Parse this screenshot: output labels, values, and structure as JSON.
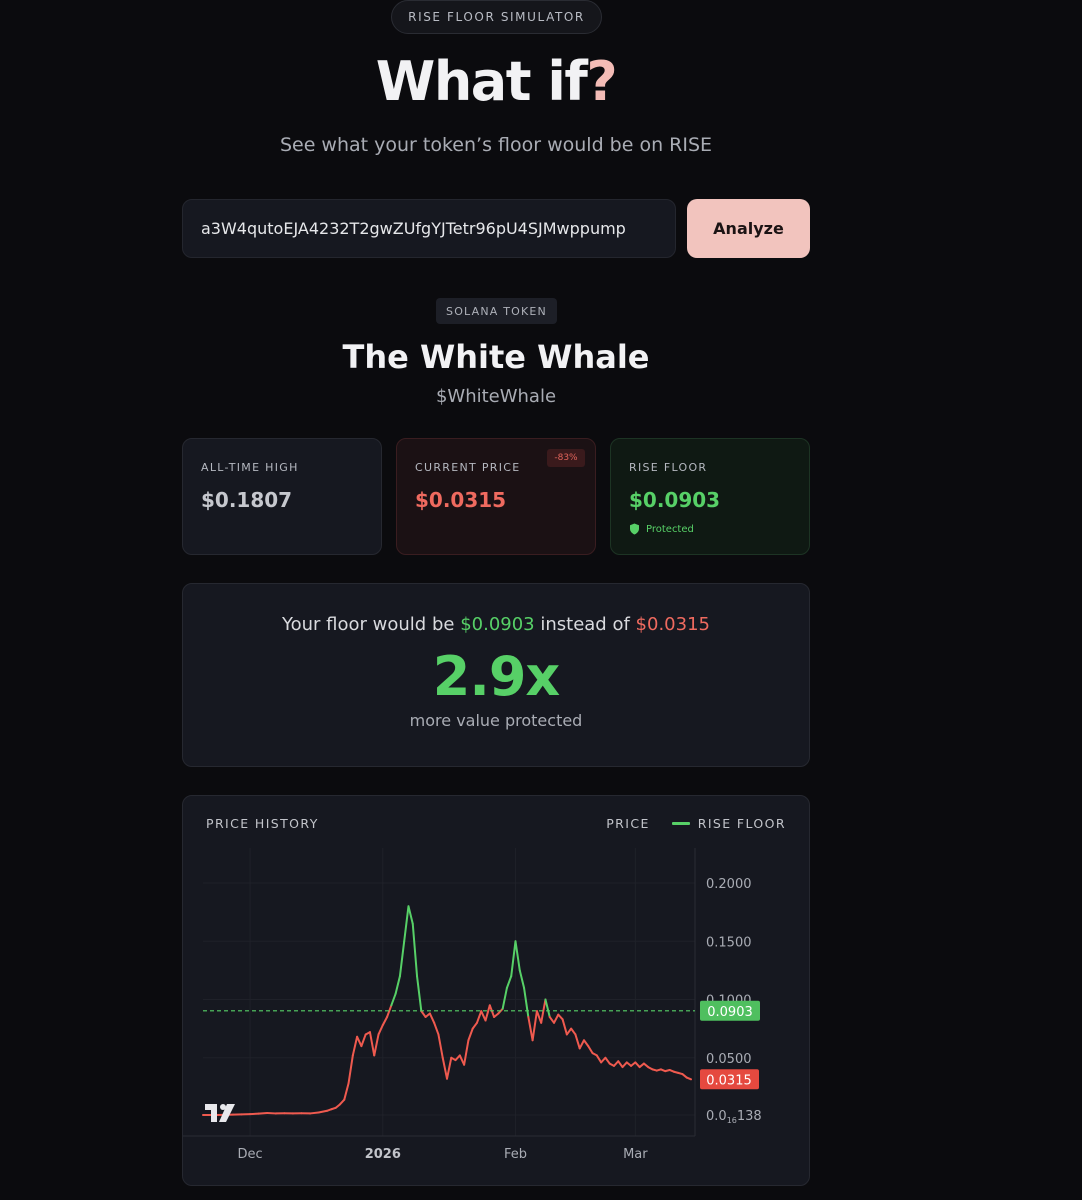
{
  "header": {
    "pill": "RISE FLOOR SIMULATOR",
    "title_main": "What if",
    "title_mark": "?",
    "subtitle": "See what your token’s floor would be on RISE"
  },
  "search": {
    "value": "a3W4qutoEJA4232T2gwZUfgYJTetr96pU4SJMwppump",
    "button": "Analyze"
  },
  "token": {
    "chain": "SOLANA TOKEN",
    "name": "The White Whale",
    "symbol": "$WhiteWhale"
  },
  "stats": {
    "ath_label": "ALL-TIME HIGH",
    "ath_value": "$0.1807",
    "current_label": "CURRENT PRICE",
    "current_value": "$0.0315",
    "change": "-83%",
    "floor_label": "RISE FLOOR",
    "floor_value": "$0.0903",
    "protected": "Protected"
  },
  "comparison": {
    "prefix": "Your floor would be",
    "floor": "$0.0903",
    "middle": "instead of",
    "current": "$0.0315",
    "multiplier": "2.9x",
    "caption": "more value protected"
  },
  "colors": {
    "accent_pink": "#f2c4be",
    "green": "#57d067",
    "red": "#ef6a5f",
    "background": "#0b0b0e",
    "card": "#161820"
  },
  "chart_data": {
    "type": "line",
    "title": "PRICE HISTORY",
    "legend": [
      "PRICE",
      "RISE FLOOR"
    ],
    "legend_placement": "top-right",
    "grid": true,
    "x_ticks": [
      "Dec",
      "2026",
      "Feb",
      "Mar"
    ],
    "y_ticks": [
      "0.2000",
      "0.1500",
      "0.1000",
      "0.0500"
    ],
    "y_min_label_main": "0.0",
    "y_min_label_sub": "16",
    "y_min_label_tail": "138",
    "ylim": [
      0,
      0.2
    ],
    "floor_value": 0.0903,
    "floor_label": "0.0903",
    "current_value": 0.0315,
    "current_label": "0.0315",
    "series": [
      {
        "name": "PRICE",
        "x": [
          "2025-11-20",
          "2025-11-23",
          "2025-11-25",
          "2025-11-27",
          "2025-11-29",
          "2025-12-01",
          "2025-12-03",
          "2025-12-05",
          "2025-12-07",
          "2025-12-09",
          "2025-12-11",
          "2025-12-13",
          "2025-12-15",
          "2025-12-17",
          "2025-12-19",
          "2025-12-20",
          "2025-12-21",
          "2025-12-22",
          "2025-12-23",
          "2025-12-24",
          "2025-12-25",
          "2025-12-26",
          "2025-12-27",
          "2025-12-28",
          "2025-12-29",
          "2025-12-30",
          "2025-12-31",
          "2026-01-01",
          "2026-01-02",
          "2026-01-03",
          "2026-01-04",
          "2026-01-05",
          "2026-01-06",
          "2026-01-07",
          "2026-01-08",
          "2026-01-09",
          "2026-01-10",
          "2026-01-11",
          "2026-01-12",
          "2026-01-13",
          "2026-01-14",
          "2026-01-15",
          "2026-01-16",
          "2026-01-17",
          "2026-01-18",
          "2026-01-19",
          "2026-01-20",
          "2026-01-21",
          "2026-01-22",
          "2026-01-23",
          "2026-01-24",
          "2026-01-25",
          "2026-01-26",
          "2026-01-27",
          "2026-01-28",
          "2026-01-29",
          "2026-01-30",
          "2026-01-31",
          "2026-02-01",
          "2026-02-02",
          "2026-02-03",
          "2026-02-04",
          "2026-02-05",
          "2026-02-06",
          "2026-02-07",
          "2026-02-08",
          "2026-02-09",
          "2026-02-10",
          "2026-02-11",
          "2026-02-12",
          "2026-02-13",
          "2026-02-14",
          "2026-02-15",
          "2026-02-16",
          "2026-02-17",
          "2026-02-18",
          "2026-02-19",
          "2026-02-20",
          "2026-02-21",
          "2026-02-22",
          "2026-02-23",
          "2026-02-24",
          "2026-02-25",
          "2026-02-26",
          "2026-02-27",
          "2026-02-28",
          "2026-03-01",
          "2026-03-02",
          "2026-03-03",
          "2026-03-04",
          "2026-03-05",
          "2026-03-06",
          "2026-03-07",
          "2026-03-08",
          "2026-03-09",
          "2026-03-10",
          "2026-03-11",
          "2026-03-12",
          "2026-03-13",
          "2026-03-14"
        ],
        "values": [
          0.0009,
          0.0009,
          0.001,
          0.0012,
          0.0014,
          0.0016,
          0.002,
          0.0026,
          0.0022,
          0.0024,
          0.0022,
          0.0024,
          0.0022,
          0.003,
          0.0045,
          0.0058,
          0.007,
          0.01,
          0.014,
          0.028,
          0.052,
          0.068,
          0.06,
          0.07,
          0.072,
          0.052,
          0.07,
          0.078,
          0.085,
          0.095,
          0.105,
          0.12,
          0.15,
          0.18,
          0.165,
          0.12,
          0.09,
          0.085,
          0.088,
          0.08,
          0.07,
          0.05,
          0.032,
          0.05,
          0.048,
          0.052,
          0.044,
          0.065,
          0.075,
          0.08,
          0.09,
          0.082,
          0.095,
          0.085,
          0.088,
          0.092,
          0.11,
          0.12,
          0.15,
          0.125,
          0.11,
          0.085,
          0.065,
          0.09,
          0.08,
          0.1,
          0.085,
          0.08,
          0.087,
          0.083,
          0.07,
          0.075,
          0.07,
          0.058,
          0.065,
          0.06,
          0.054,
          0.052,
          0.046,
          0.05,
          0.045,
          0.043,
          0.047,
          0.042,
          0.046,
          0.043,
          0.046,
          0.042,
          0.045,
          0.042,
          0.04,
          0.039,
          0.04,
          0.0385,
          0.0395,
          0.038,
          0.037,
          0.036,
          0.033,
          0.0315
        ]
      }
    ]
  }
}
